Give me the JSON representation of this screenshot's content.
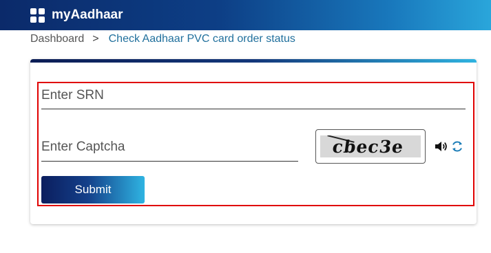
{
  "header": {
    "app_title": "myAadhaar"
  },
  "breadcrumb": {
    "home": "Dashboard",
    "separator": ">",
    "current": "Check Aadhaar PVC card order status"
  },
  "form": {
    "srn_placeholder": "Enter SRN",
    "captcha_placeholder": "Enter Captcha",
    "captcha_text": "cbec3e",
    "submit_label": "Submit"
  },
  "icons": {
    "logo": "grid-logo-icon",
    "audio": "speaker-icon",
    "refresh": "refresh-icon"
  },
  "colors": {
    "header_dark": "#0b2a6a",
    "header_light": "#2aa6db",
    "accent": "#1f6f9c",
    "highlight_border": "#e00000"
  }
}
